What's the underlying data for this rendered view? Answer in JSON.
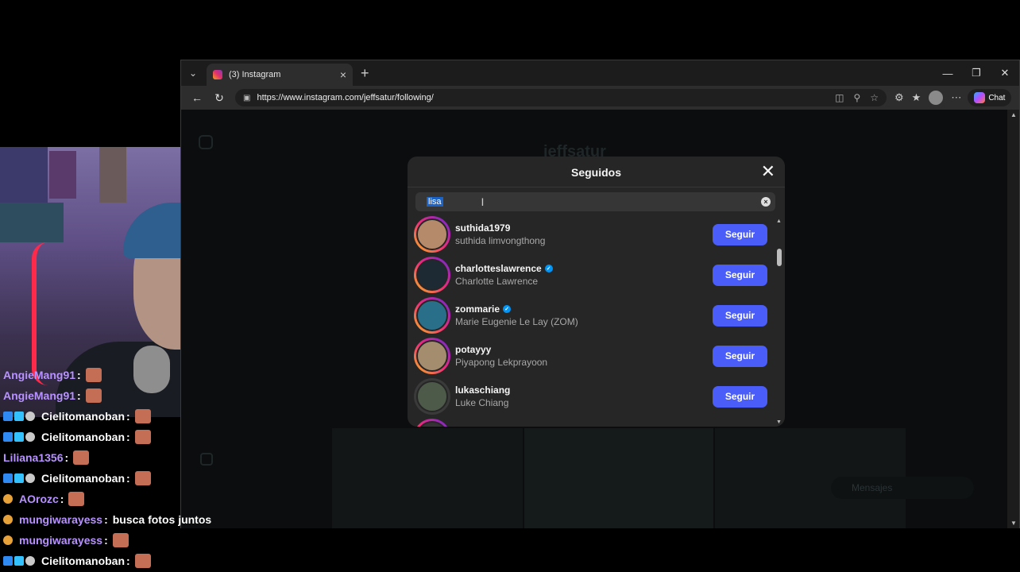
{
  "browser": {
    "tab_title": "(3) Instagram",
    "url": "https://www.instagram.com/jeffsatur/following/",
    "chat_label": "Chat",
    "icons": [
      "tab-menu-icon",
      "instagram-icon",
      "close-tab-icon",
      "new-tab-icon",
      "back-icon",
      "refresh-icon",
      "lock-icon",
      "minimize-icon",
      "restore-icon",
      "close-window-icon"
    ]
  },
  "background_page": {
    "username": "jeffsatur",
    "messages_label": "Mensajes"
  },
  "modal": {
    "title": "Seguidos",
    "search_value": "lisa",
    "users": [
      {
        "username": "suthida1979",
        "full_name": "suthida limvongthong",
        "verified": false,
        "button": "Seguir"
      },
      {
        "username": "charlotteslawrence",
        "full_name": "Charlotte Lawrence",
        "verified": true,
        "button": "Seguir"
      },
      {
        "username": "zommarie",
        "full_name": "Marie Eugenie Le Lay (ZOM)",
        "verified": true,
        "button": "Seguir"
      },
      {
        "username": "potayyy",
        "full_name": "Piyapong Lekprayoon",
        "verified": false,
        "button": "Seguir"
      },
      {
        "username": "lukaschiang",
        "full_name": "Luke Chiang",
        "verified": false,
        "button": "Seguir"
      }
    ]
  },
  "chat": [
    {
      "user": "AngieMang91",
      "badges": "none",
      "message": ""
    },
    {
      "user": "AngieMang91",
      "badges": "none",
      "message": ""
    },
    {
      "user": "Cielitomanoban",
      "badges": "triple",
      "message": ""
    },
    {
      "user": "Cielitomanoban",
      "badges": "triple",
      "message": ""
    },
    {
      "user": "Liliana1356",
      "badges": "none",
      "message": ""
    },
    {
      "user": "Cielitomanoban",
      "badges": "triple",
      "message": ""
    },
    {
      "user": "AOrozc",
      "badges": "gold",
      "message": ""
    },
    {
      "user": "mungiwarayess",
      "badges": "gold",
      "message": "busca fotos juntos"
    },
    {
      "user": "mungiwarayess",
      "badges": "gold",
      "message": ""
    },
    {
      "user": "Cielitomanoban",
      "badges": "triple",
      "message": ""
    }
  ],
  "colors": {
    "follow_button": "#4a5df9",
    "chat_username": "#b892ff",
    "verified": "#0095f6"
  }
}
